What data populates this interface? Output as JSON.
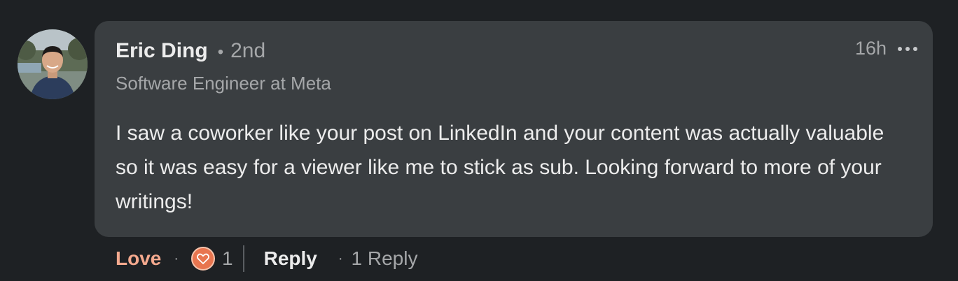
{
  "comment": {
    "author": {
      "name": "Eric Ding",
      "separator": "•",
      "connection_degree": "2nd",
      "headline": "Software Engineer at Meta",
      "avatar_icon": "profile-photo"
    },
    "timestamp": "16h",
    "more_icon": "more-horizontal-icon",
    "text": "I saw a coworker like your post on LinkedIn and your content was actually valuable so it was easy for a viewer like me to stick as sub. Looking forward to more of your writings!",
    "actions": {
      "reaction_label": "Love",
      "dot": "·",
      "reaction_icon": "heart-icon",
      "reaction_count": "1",
      "reply_label": "Reply",
      "replies_count_label": "1 Reply"
    }
  },
  "colors": {
    "background": "#1e2124",
    "bubble": "#3a3e41",
    "primary_text": "#ececec",
    "secondary_text": "#a5a7a9",
    "love_accent": "#f4a98e",
    "heart_fill": "#e8754f"
  }
}
